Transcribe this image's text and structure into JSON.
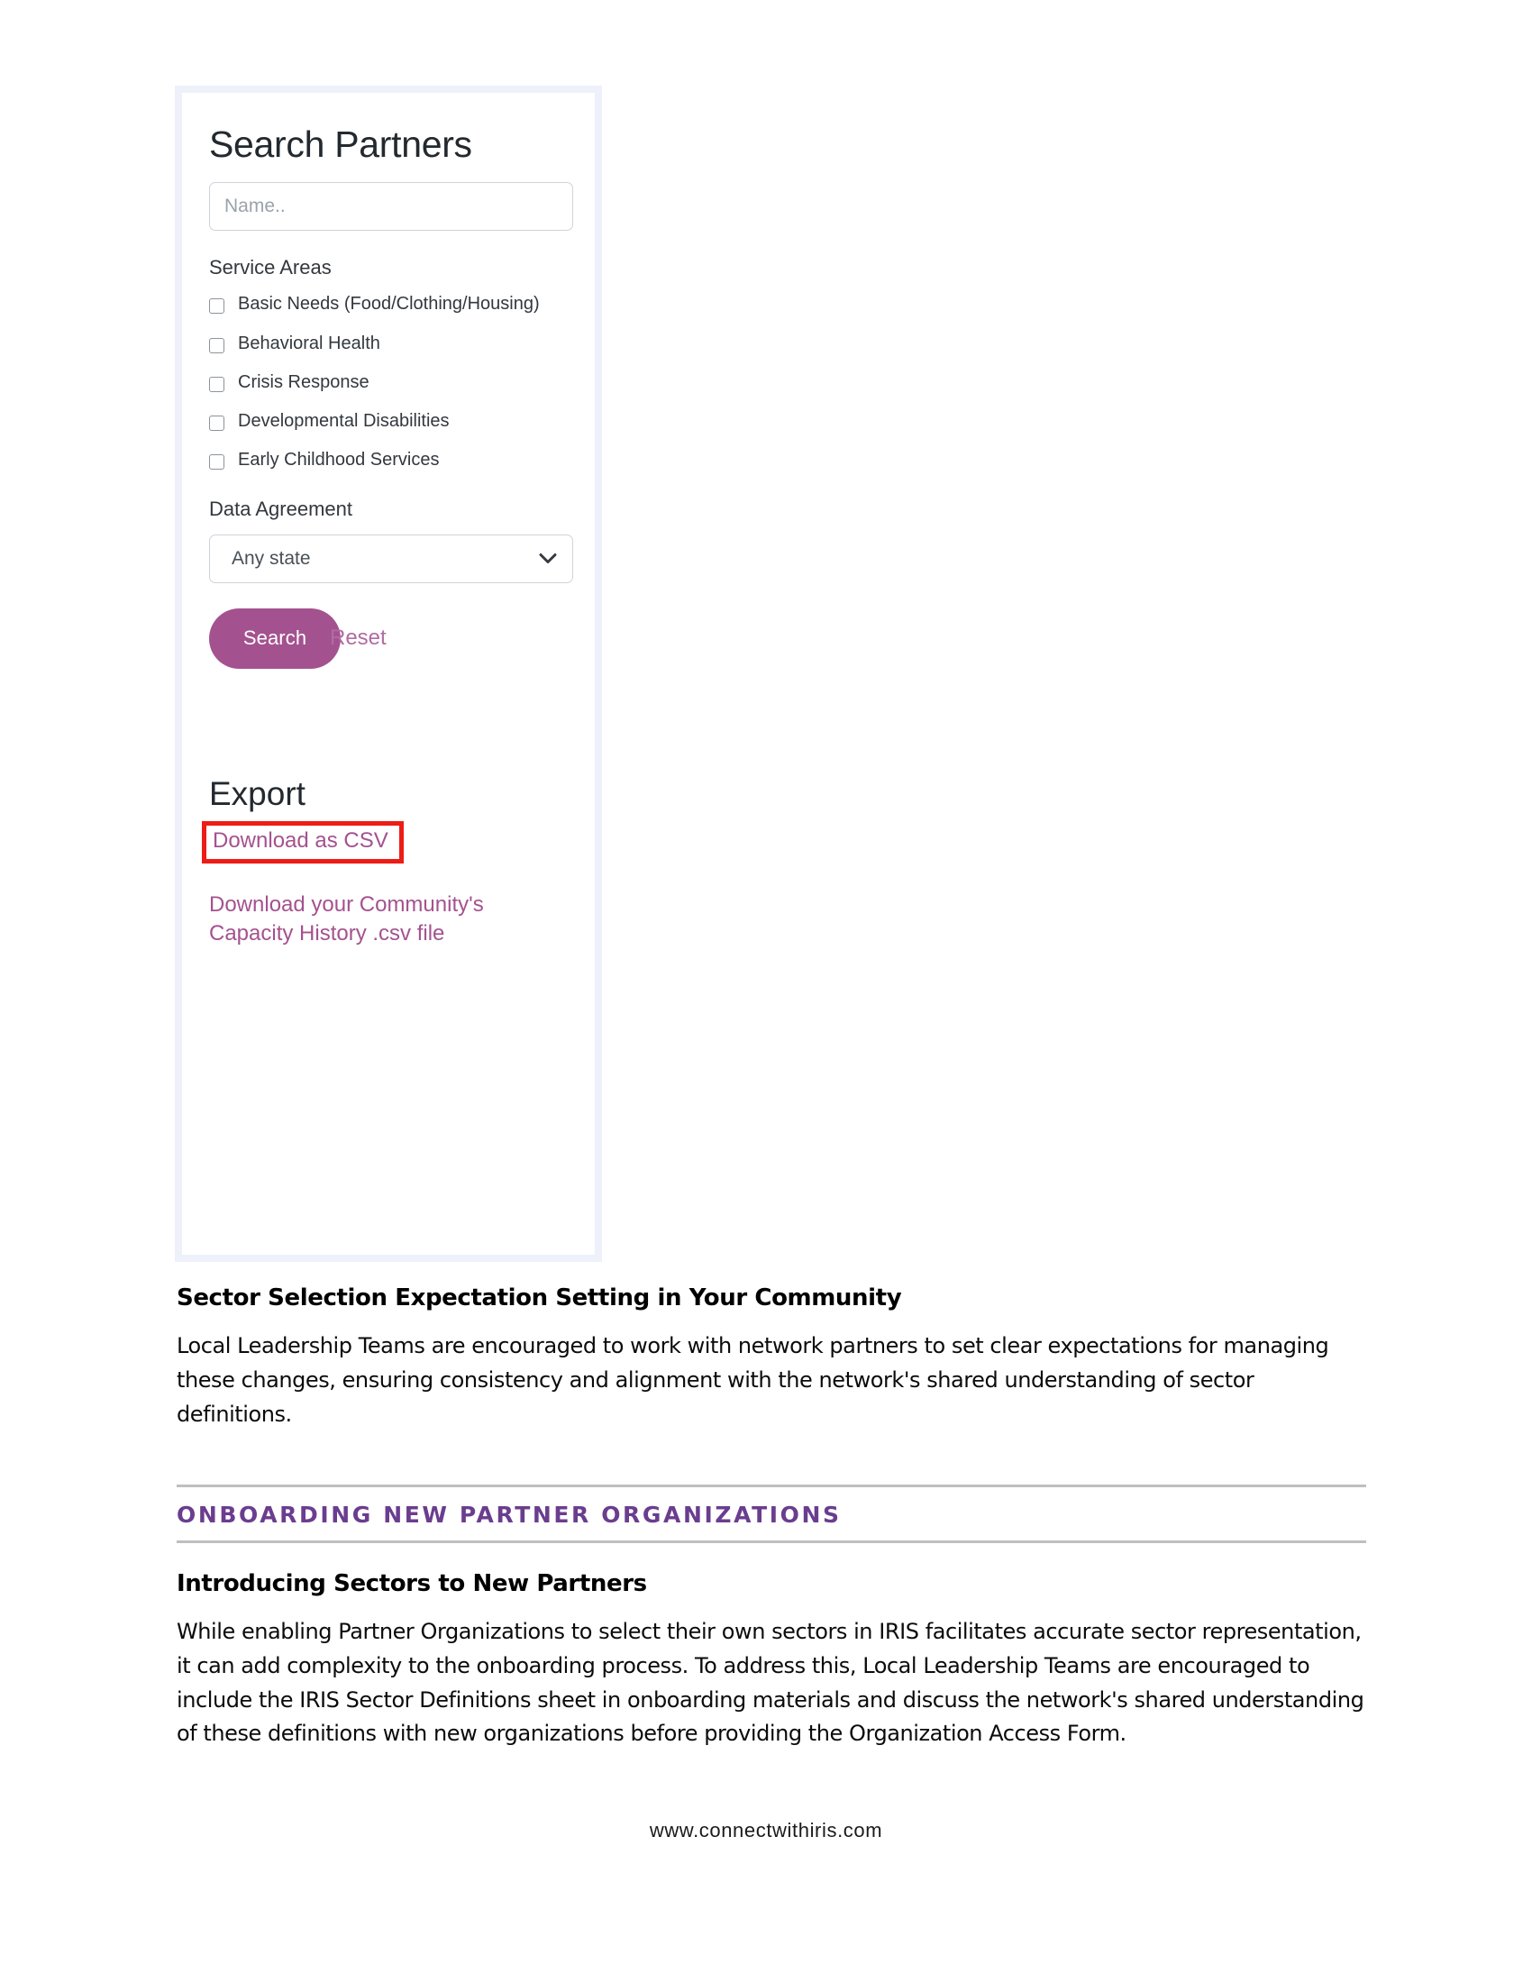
{
  "app_panel": {
    "title": "Search Partners",
    "name_input": {
      "placeholder": "Name..",
      "value": ""
    },
    "service_areas": {
      "label": "Service Areas",
      "options": [
        {
          "label": "Basic Needs (Food/Clothing/Housing)",
          "checked": false
        },
        {
          "label": "Behavioral Health",
          "checked": false
        },
        {
          "label": "Crisis Response",
          "checked": false
        },
        {
          "label": "Developmental Disabilities",
          "checked": false
        },
        {
          "label": "Early Childhood Services",
          "checked": false
        }
      ]
    },
    "data_agreement": {
      "label": "Data Agreement",
      "selected": "Any state"
    },
    "search_button": "Search",
    "reset_link": "Reset",
    "export": {
      "title": "Export",
      "csv_link": "Download as CSV",
      "capacity_history_link": "Download your Community's Capacity History .csv file"
    },
    "colors": {
      "accent_purple": "#a4528f",
      "reset_link": "#b06ca2",
      "highlight_red": "#ee1c16",
      "panel_border": "#eef1f9"
    }
  },
  "document": {
    "heading_1": "Sector Selection Expectation Setting in Your Community",
    "paragraph_1": "Local Leadership Teams are encouraged to work with network partners to set clear expectations for managing these changes, ensuring consistency and alignment with the network's shared understanding of sector definitions.",
    "section_heading": "ONBOARDING NEW PARTNER ORGANIZATIONS",
    "heading_2": "Introducing Sectors to New Partners",
    "paragraph_2": "While enabling Partner Organizations to select their own sectors in IRIS facilitates accurate sector representation, it can add complexity to the onboarding process. To address this, Local Leadership Teams are encouraged to include the IRIS Sector Definitions sheet in onboarding materials and discuss the network's shared understanding of these definitions with new organizations before providing the Organization Access Form.",
    "section_heading_color": "#6b3d8e"
  },
  "footer": {
    "url": "www.connectwithiris.com"
  }
}
